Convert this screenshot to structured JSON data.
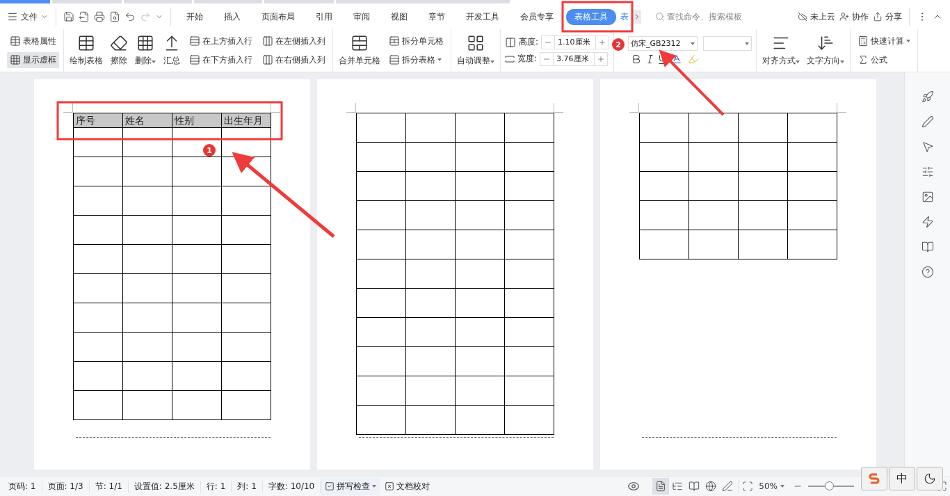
{
  "menu": {
    "file_label": "文件",
    "tabs": [
      {
        "label": "开始",
        "selected": false
      },
      {
        "label": "插入",
        "selected": false
      },
      {
        "label": "页面布局",
        "selected": false
      },
      {
        "label": "引用",
        "selected": false
      },
      {
        "label": "审阅",
        "selected": false
      },
      {
        "label": "视图",
        "selected": false
      },
      {
        "label": "章节",
        "selected": false
      },
      {
        "label": "开发工具",
        "selected": false
      },
      {
        "label": "会员专享",
        "selected": false
      },
      {
        "label": "表格工具",
        "selected": true
      },
      {
        "label": "表",
        "selected": false
      }
    ],
    "search": {
      "placeholder": "查找命令、搜索模板"
    },
    "actions": [
      {
        "label": "未上云"
      },
      {
        "label": "协作"
      },
      {
        "label": "分享"
      }
    ]
  },
  "ribbon": {
    "groups": [
      {
        "columns": [
          {
            "kind": "stack",
            "items": [
              {
                "label": "表格属性",
                "dropdown": false,
                "on": false
              },
              {
                "label": "显示虚框",
                "dropdown": false,
                "on": true
              }
            ]
          }
        ]
      },
      {
        "columns": [
          {
            "kind": "large",
            "label": "绘制表格",
            "dropdown": false
          },
          {
            "kind": "large",
            "label": "擦除",
            "dropdown": false
          },
          {
            "kind": "large",
            "label": "删除",
            "dropdown": true
          },
          {
            "kind": "large",
            "label": "汇总",
            "dropdown": false
          },
          {
            "kind": "stack",
            "items": [
              {
                "label": "在上方插入行",
                "dropdown": false,
                "on": false
              },
              {
                "label": "在下方插入行",
                "dropdown": false,
                "on": false
              }
            ]
          },
          {
            "kind": "stack",
            "items": [
              {
                "label": "在左侧插入列",
                "dropdown": false,
                "on": false
              },
              {
                "label": "在右侧插入列",
                "dropdown": false,
                "on": false
              }
            ]
          }
        ]
      },
      {
        "columns": [
          {
            "kind": "large",
            "label": "合并单元格",
            "dropdown": false
          },
          {
            "kind": "stack",
            "items": [
              {
                "label": "拆分单元格",
                "dropdown": false,
                "on": false
              },
              {
                "label": "拆分表格",
                "dropdown": true,
                "on": false
              }
            ]
          }
        ]
      },
      {
        "columns": [
          {
            "kind": "large",
            "label": "自动调整",
            "dropdown": true
          }
        ]
      },
      {
        "columns": [
          {
            "kind": "spinners",
            "items": [
              {
                "label": "高度:",
                "value": "1.10厘米"
              },
              {
                "label": "宽度:",
                "value": "3.76厘米"
              }
            ]
          }
        ]
      },
      {
        "columns": [
          {
            "kind": "font",
            "font": "仿宋_GB2312"
          }
        ]
      },
      {
        "columns": [
          {
            "kind": "large",
            "label": "对齐方式",
            "dropdown": true
          },
          {
            "kind": "large",
            "label": "文字方向",
            "dropdown": true
          }
        ]
      },
      {
        "columns": [
          {
            "kind": "stack",
            "items": [
              {
                "label": "快速计算",
                "dropdown": true,
                "on": false
              },
              {
                "label": "公式",
                "dropdown": false,
                "on": false
              }
            ]
          }
        ]
      }
    ]
  },
  "pages": [
    {
      "header": [
        "序号",
        "姓名",
        "性别",
        "出生年月"
      ],
      "columns": [
        {
          "kind": "plain"
        },
        {
          "kind": "plain"
        },
        {
          "kind": "plain"
        },
        {
          "kind": "plain"
        }
      ],
      "rows": [
        {
          "kind": "blank"
        },
        {
          "kind": "blank"
        },
        {
          "kind": "blank"
        },
        {
          "kind": "blank"
        },
        {
          "kind": "blank"
        },
        {
          "kind": "blank"
        },
        {
          "kind": "blank"
        },
        {
          "kind": "blank"
        },
        {
          "kind": "blank"
        },
        {
          "kind": "blank"
        }
      ]
    },
    {
      "columns": [
        {
          "kind": "plain"
        },
        {
          "kind": "plain"
        },
        {
          "kind": "plain"
        },
        {
          "kind": "plain"
        }
      ],
      "rows": [
        {
          "kind": "blank"
        },
        {
          "kind": "blank"
        },
        {
          "kind": "blank"
        },
        {
          "kind": "blank"
        },
        {
          "kind": "blank"
        },
        {
          "kind": "blank"
        },
        {
          "kind": "blank"
        },
        {
          "kind": "blank"
        },
        {
          "kind": "blank"
        },
        {
          "kind": "blank"
        },
        {
          "kind": "blank"
        }
      ]
    },
    {
      "columns": [
        {
          "kind": "plain"
        },
        {
          "kind": "plain"
        },
        {
          "kind": "plain"
        },
        {
          "kind": "plain"
        }
      ],
      "rows": [
        {
          "kind": "blank"
        },
        {
          "kind": "blank"
        },
        {
          "kind": "blank"
        },
        {
          "kind": "blank"
        },
        {
          "kind": "blank"
        }
      ]
    }
  ],
  "annotations": [
    {
      "badge": "1"
    },
    {
      "badge": "2"
    }
  ],
  "status_bar": {
    "items": [
      {
        "kind": "text",
        "label": "页码: 1"
      },
      {
        "kind": "text",
        "label": "页面: 1/3"
      },
      {
        "kind": "text",
        "label": "节: 1/1"
      },
      {
        "kind": "text",
        "label": "设置值: 2.5厘米"
      },
      {
        "kind": "text",
        "label": "行: 1"
      },
      {
        "kind": "text",
        "label": "列: 1"
      },
      {
        "kind": "text",
        "label": "字数: 10/10"
      },
      {
        "kind": "spell",
        "label": "拼写检查"
      },
      {
        "kind": "proof",
        "label": "文档校对"
      }
    ],
    "views": [
      {
        "selected": true
      },
      {
        "selected": false
      },
      {
        "selected": false
      },
      {
        "selected": false
      },
      {
        "selected": false
      }
    ],
    "zoom": "50%",
    "zoom_slider": {
      "level": 0.45
    }
  },
  "ime": {
    "label": "中"
  }
}
